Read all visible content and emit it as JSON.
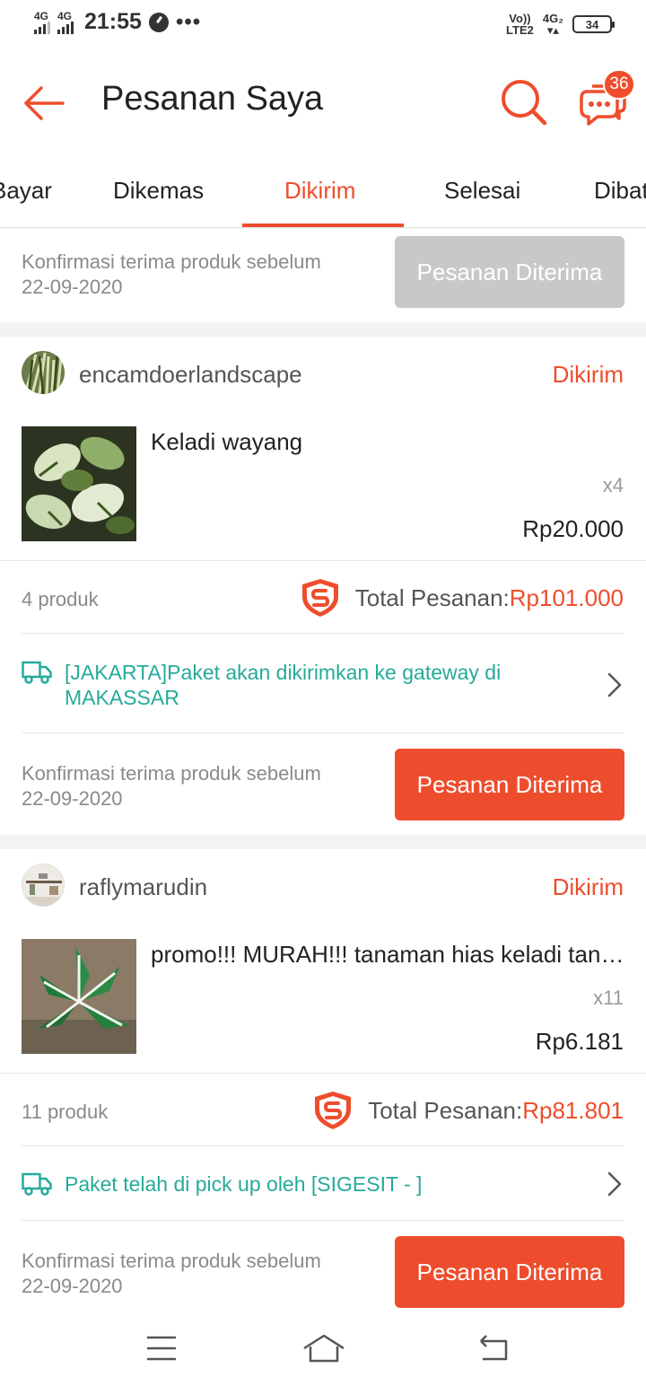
{
  "status_bar": {
    "sim1_label": "4G",
    "sim2_label": "4G",
    "time": "21:55",
    "more": "•••",
    "volte_top": "Vo))",
    "volte_bottom": "LTE2",
    "net2_top": "4G₂",
    "battery": "34"
  },
  "header": {
    "title": "Pesanan Saya",
    "chat_badge": "36"
  },
  "tabs": [
    "Bayar",
    "Dikemas",
    "Dikirim",
    "Selesai",
    "Dibatalkan"
  ],
  "active_tab": "Dikirim",
  "top_partial": {
    "confirm_line1": "Konfirmasi terima produk sebelum",
    "confirm_line2": "22-09-2020",
    "button": "Pesanan Diterima"
  },
  "orders": [
    {
      "shop": "encamdoerlandscape",
      "status": "Dikirim",
      "product_name": "Keladi wayang",
      "quantity": "x4",
      "price": "Rp20.000",
      "product_count": "4 produk",
      "total_label": "Total Pesanan: ",
      "total_amount": "Rp101.000",
      "shipping": "[JAKARTA]Paket akan dikirimkan ke gateway di MAKASSAR",
      "confirm_line1": "Konfirmasi terima produk sebelum",
      "confirm_line2": "22-09-2020",
      "button": "Pesanan Diterima"
    },
    {
      "shop": "raflymarudin",
      "status": "Dikirim",
      "product_name": "promo!!!  MURAH!!! tanaman hias keladi tangkai putih",
      "quantity": "x11",
      "price": "Rp6.181",
      "product_count": "11 produk",
      "total_label": "Total Pesanan: ",
      "total_amount": "Rp81.801",
      "shipping": "Paket telah di pick up oleh [SIGESIT - ]",
      "confirm_line1": "Konfirmasi terima produk sebelum",
      "confirm_line2": "22-09-2020",
      "button": "Pesanan Diterima"
    }
  ],
  "colors": {
    "accent": "#ee4d2d",
    "shipping_text": "#26aa99",
    "disabled_button": "#c8c8c8",
    "muted_text": "#8a8a8a"
  },
  "icons": {
    "back": "arrow-left-icon",
    "search": "search-icon",
    "chat": "chat-icon",
    "guarantee": "shield-icon",
    "shipping": "truck-icon",
    "next": "chevron-right-icon",
    "nav": [
      "menu-icon",
      "home-icon",
      "back-nav-icon"
    ]
  }
}
